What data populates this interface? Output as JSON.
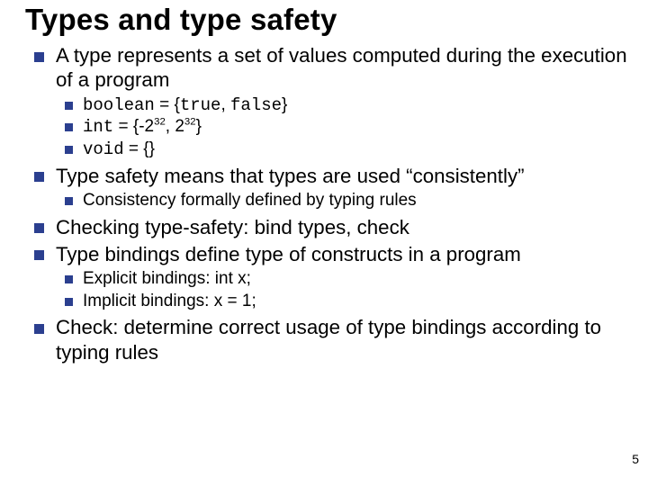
{
  "title": "Types and type safety",
  "bullets": [
    {
      "text": "A type represents a set of values computed during the execution of a program",
      "sub": [
        {
          "html": "<span class='code'>boolean</span> = {<span class='code'>true</span>, <span class='code'>false</span>}"
        },
        {
          "html": "<span class='code'>int</span> = {-2<sup>32</sup>, 2<sup>32</sup>}"
        },
        {
          "html": "<span class='code'>void</span> = {}"
        }
      ]
    },
    {
      "text": "Type safety means that types are used “consistently”",
      "sub": [
        {
          "text": "Consistency formally defined by typing rules"
        }
      ]
    },
    {
      "text": "Checking type-safety: bind types, check"
    },
    {
      "text": "Type bindings define type of constructs in a program",
      "sub": [
        {
          "text": "Explicit bindings: int x;"
        },
        {
          "text": "Implicit bindings: x = 1;"
        }
      ]
    },
    {
      "text": "Check: determine correct usage of type bindings according to typing rules"
    }
  ],
  "page_number": "5"
}
